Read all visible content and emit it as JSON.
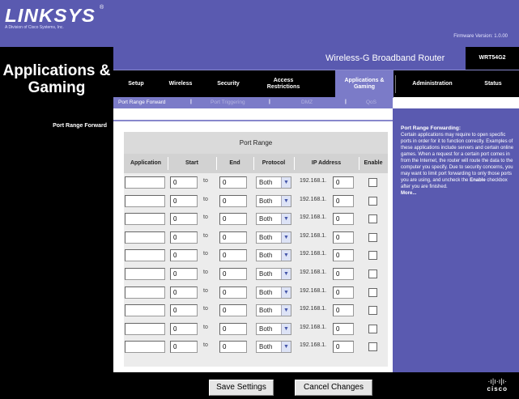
{
  "brand": {
    "name": "LINKSYS",
    "tm": "®",
    "tagline": "A Division of Cisco Systems, Inc."
  },
  "firmware": "Firmware Version: 1.0.00",
  "section_title": "Applications & Gaming",
  "product": {
    "name": "Wireless-G Broadband Router",
    "model": "WRT54G2"
  },
  "tabs": [
    {
      "label": "Setup"
    },
    {
      "label": "Wireless"
    },
    {
      "label": "Security"
    },
    {
      "label": "Access Restrictions"
    },
    {
      "label": "Applications & Gaming"
    },
    {
      "label": "Administration"
    },
    {
      "label": "Status"
    }
  ],
  "subtabs": [
    {
      "label": "Port Range Forward"
    },
    {
      "label": "Port Triggering"
    },
    {
      "label": "DMZ"
    },
    {
      "label": "QoS"
    }
  ],
  "subtab_separator": "|",
  "left_label": "Port Range Forward",
  "table": {
    "title": "Port Range",
    "headers": {
      "application": "Application",
      "start": "Start",
      "end": "End",
      "protocol": "Protocol",
      "ip": "IP Address",
      "enable": "Enable"
    },
    "to_label": "to",
    "ip_prefix": "192.168.1.",
    "rows": [
      {
        "application": "",
        "start": "0",
        "end": "0",
        "protocol": "Both",
        "ip": "0"
      },
      {
        "application": "",
        "start": "0",
        "end": "0",
        "protocol": "Both",
        "ip": "0"
      },
      {
        "application": "",
        "start": "0",
        "end": "0",
        "protocol": "Both",
        "ip": "0"
      },
      {
        "application": "",
        "start": "0",
        "end": "0",
        "protocol": "Both",
        "ip": "0"
      },
      {
        "application": "",
        "start": "0",
        "end": "0",
        "protocol": "Both",
        "ip": "0"
      },
      {
        "application": "",
        "start": "0",
        "end": "0",
        "protocol": "Both",
        "ip": "0"
      },
      {
        "application": "",
        "start": "0",
        "end": "0",
        "protocol": "Both",
        "ip": "0"
      },
      {
        "application": "",
        "start": "0",
        "end": "0",
        "protocol": "Both",
        "ip": "0"
      },
      {
        "application": "",
        "start": "0",
        "end": "0",
        "protocol": "Both",
        "ip": "0"
      },
      {
        "application": "",
        "start": "0",
        "end": "0",
        "protocol": "Both",
        "ip": "0"
      }
    ]
  },
  "help": {
    "title": "Port Range Forwarding:",
    "text_before": "Certain applications may require to open specific ports in order for it to function correctly. Examples of these applications include servers and certain online games. When a request for a certain port comes in from the Internet, the router will route the data to the computer you specify. Due to security concerns, you may want to limit port forwarding to only those ports you are using, and uncheck the ",
    "text_bold": "Enable",
    "text_after": " checkbox after you are finished.",
    "more": "More..."
  },
  "buttons": {
    "save": "Save Settings",
    "cancel": "Cancel Changes"
  },
  "cisco": {
    "bars": "·ı|ı·ı|ı·",
    "word": "cisco"
  },
  "icons": {
    "dropdown": "chevron-down-icon",
    "logo": "cisco-logo"
  }
}
